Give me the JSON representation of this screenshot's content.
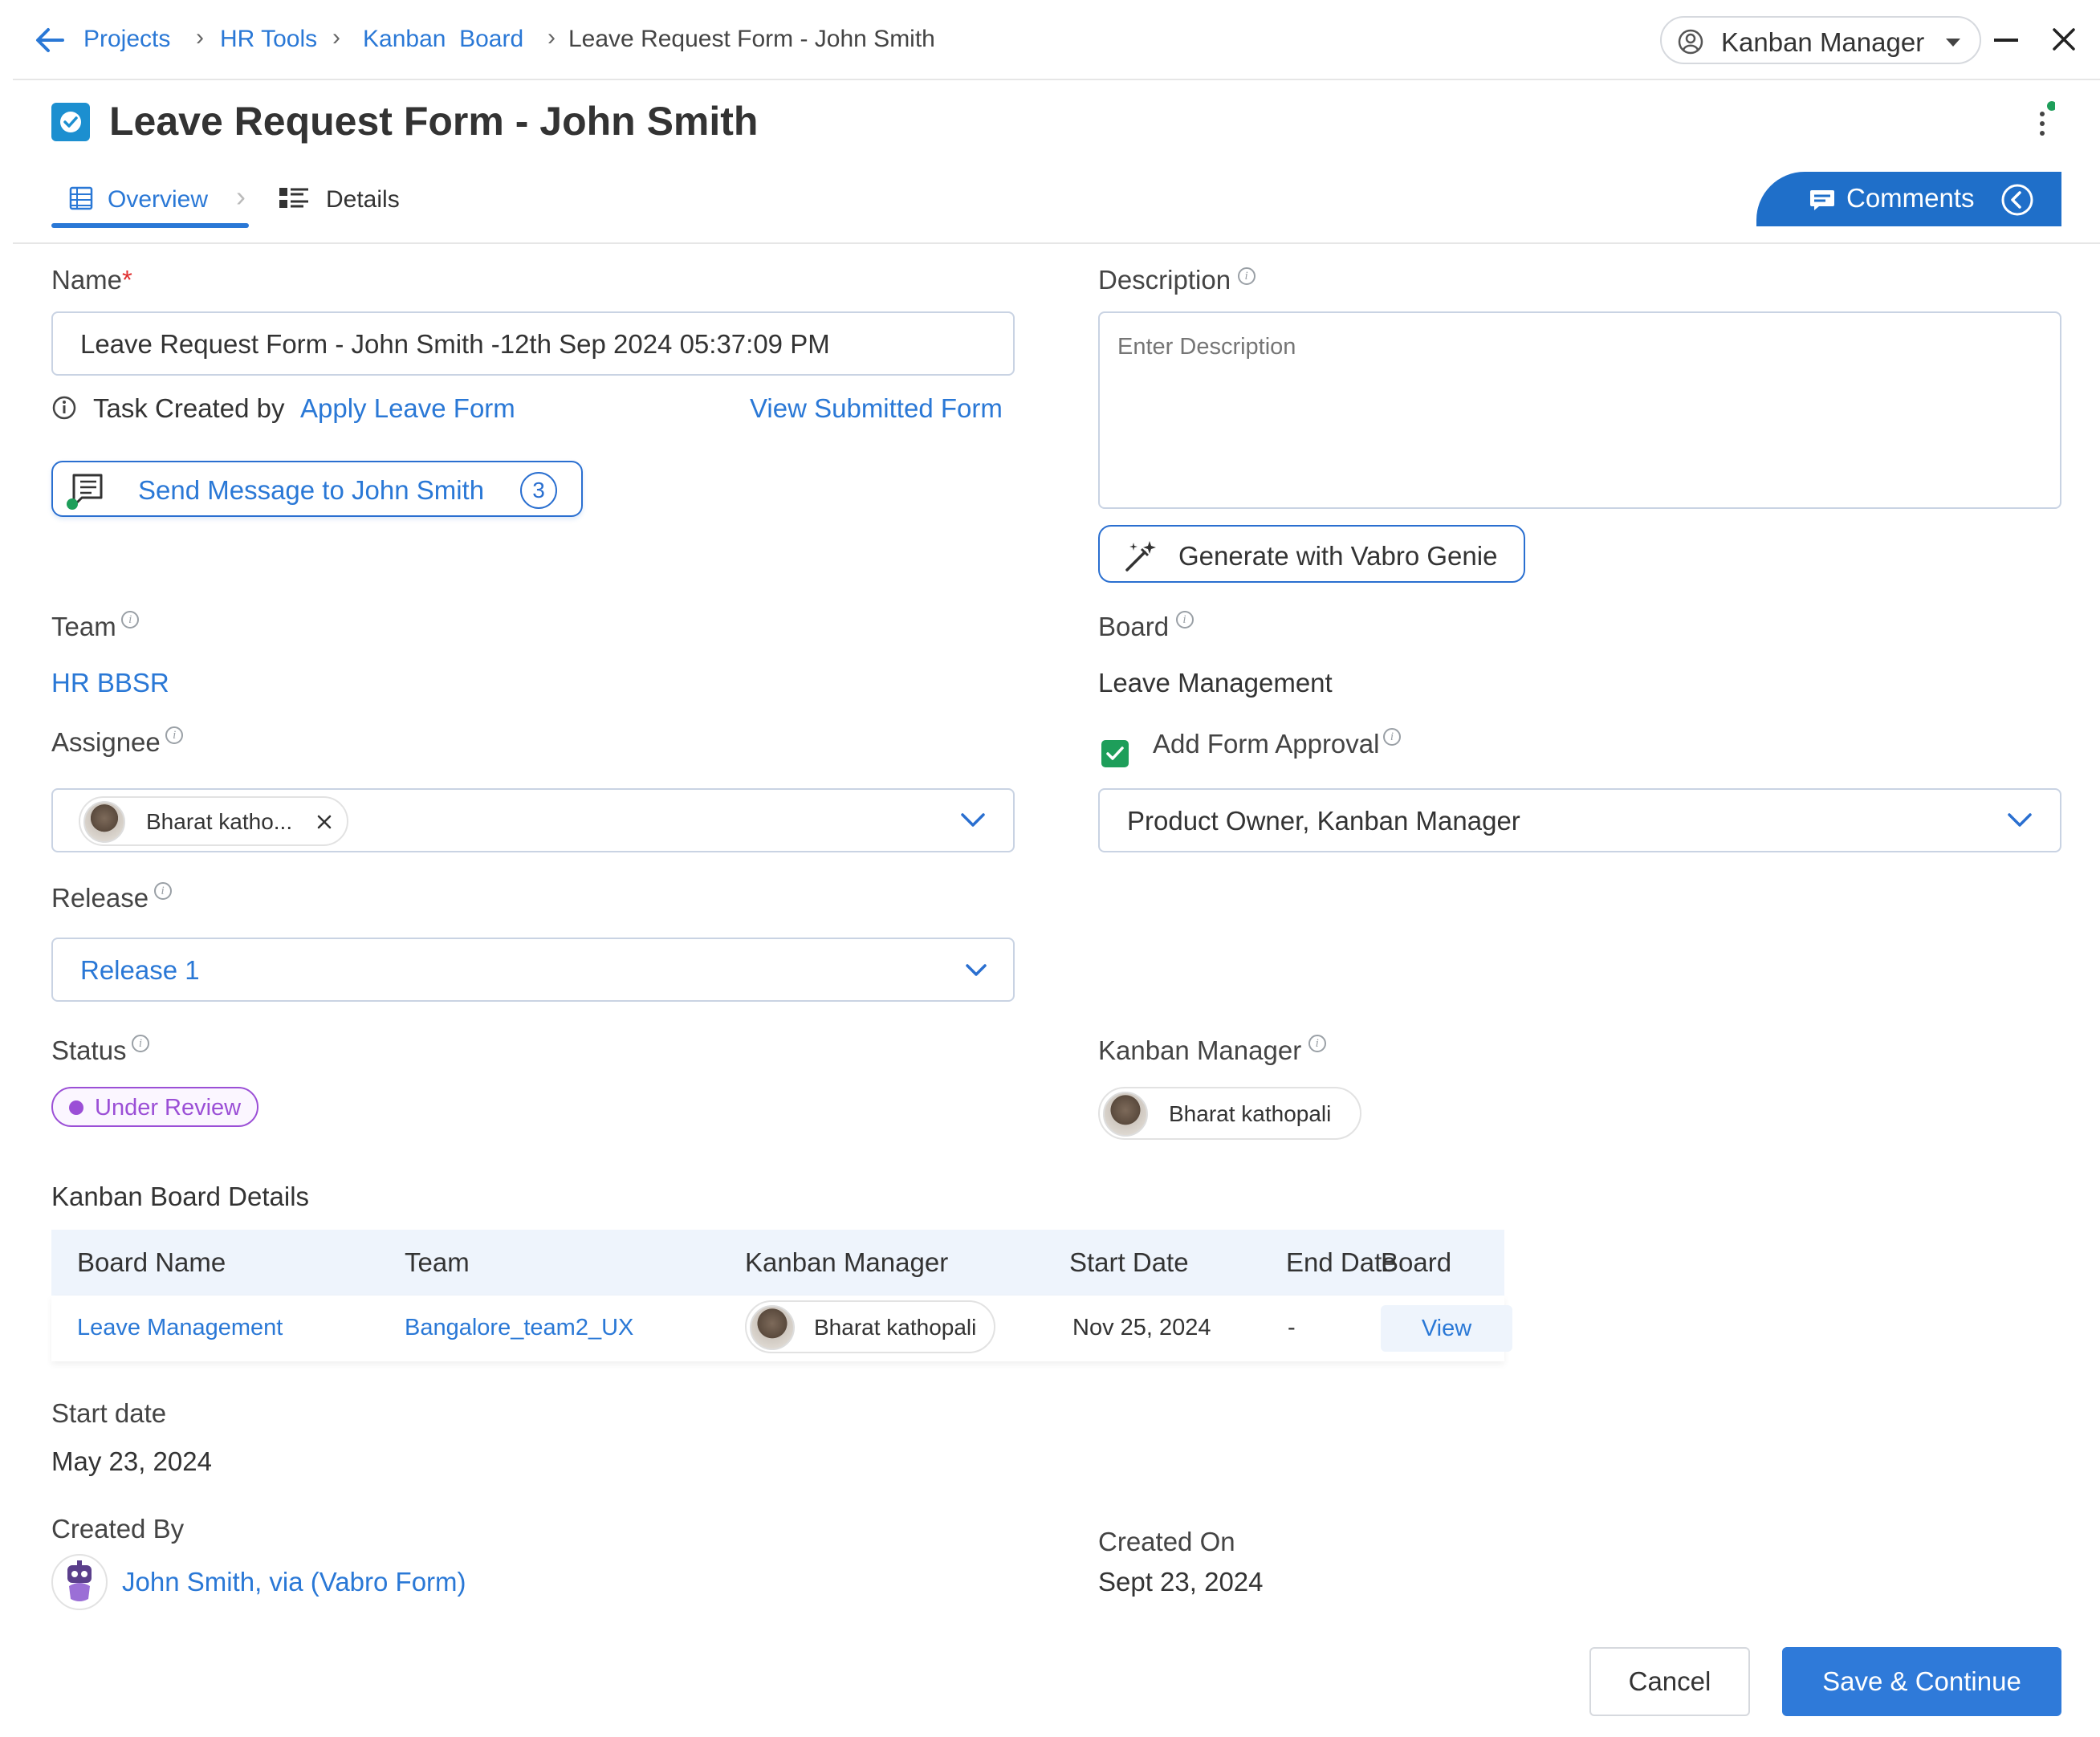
{
  "breadcrumb": {
    "items": [
      "Projects",
      "HR Tools",
      "Kanban  Board"
    ],
    "current": "Leave Request Form - John Smith"
  },
  "role_selector": {
    "value": "Kanban Manager"
  },
  "page": {
    "title": "Leave Request Form - John Smith"
  },
  "tabs": [
    {
      "label": "Overview",
      "active": true
    },
    {
      "label": "Details",
      "active": false
    }
  ],
  "comments_button": {
    "label": "Comments"
  },
  "name_field": {
    "label": "Name",
    "required_mark": "*",
    "value": "Leave Request Form - John Smith -12th Sep 2024 05:37:09 PM"
  },
  "task_created": {
    "prefix": "Task Created by",
    "link": "Apply Leave Form",
    "view_link": "View Submitted Form"
  },
  "send_message": {
    "label": "Send Message to John Smith",
    "count": "3"
  },
  "description": {
    "label": "Description",
    "placeholder": "Enter Description",
    "genie_button": "Generate with Vabro Genie"
  },
  "team": {
    "label": "Team",
    "value": "HR BBSR"
  },
  "board": {
    "label": "Board",
    "value": "Leave Management"
  },
  "assignee": {
    "label": "Assignee",
    "chip": "Bharat katho..."
  },
  "form_approval": {
    "label": "Add Form Approval",
    "checked": true,
    "value": "Product Owner, Kanban Manager"
  },
  "release": {
    "label": "Release",
    "value": "Release 1"
  },
  "status": {
    "label": "Status",
    "value": "Under Review",
    "color": "#9b4fd6"
  },
  "kanban_manager": {
    "label": "Kanban Manager",
    "chip": "Bharat kathopali"
  },
  "kanban_board_details": {
    "title": "Kanban Board Details",
    "columns": [
      "Board Name",
      "Team",
      "Kanban Manager",
      "Start Date",
      "End Date",
      "Board"
    ],
    "rows": [
      {
        "board_name": "Leave Management",
        "team": "Bangalore_team2_UX",
        "manager": "Bharat kathopali",
        "start": "Nov 25, 2024",
        "end": "-",
        "action": "View"
      }
    ]
  },
  "start_date": {
    "label": "Start date",
    "value": "May 23, 2024"
  },
  "created_by": {
    "label": "Created By",
    "value": "John Smith, via (Vabro Form)"
  },
  "created_on": {
    "label": "Created On",
    "value": "Sept 23, 2024"
  },
  "footer": {
    "cancel": "Cancel",
    "save": "Save & Continue"
  },
  "colors": {
    "accent": "#2a78d6",
    "primary_button": "#2f7ad9",
    "checkbox": "#1e9e5a",
    "status": "#9b4fd6"
  }
}
